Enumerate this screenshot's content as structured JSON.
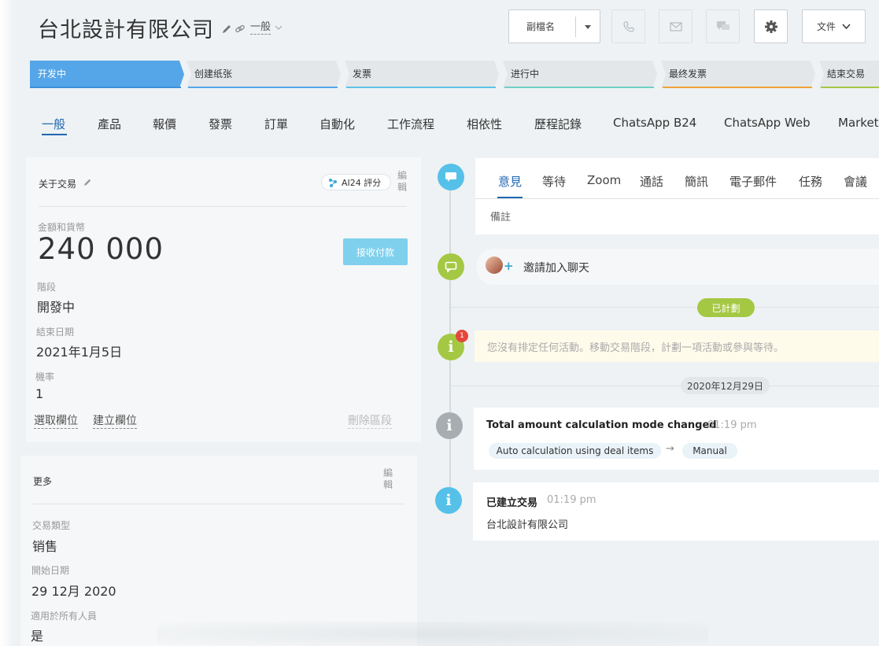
{
  "header": {
    "company_title": "台北設計有限公司",
    "category": "一般",
    "alias_label": "副檔名",
    "document_label": "文件"
  },
  "stages": [
    {
      "label": "开发中",
      "color": "#55a6e8",
      "accent": "#3c8fd8",
      "active": true
    },
    {
      "label": "创建纸张",
      "color": "#e4e7ea",
      "accent": "#55a6e8",
      "active": false
    },
    {
      "label": "发票",
      "color": "#e4e7ea",
      "accent": "#5ec2e8",
      "active": false
    },
    {
      "label": "进行中",
      "color": "#e4e7ea",
      "accent": "#6fcfc6",
      "active": false
    },
    {
      "label": "最终发票",
      "color": "#e4e7ea",
      "accent": "#f0a33b",
      "active": false
    },
    {
      "label": "結束交易",
      "color": "#e4e7ea",
      "accent": "#a5c844",
      "active": false
    }
  ],
  "tabs": [
    {
      "label": "一般",
      "active": true
    },
    {
      "label": "產品"
    },
    {
      "label": "報價"
    },
    {
      "label": "發票"
    },
    {
      "label": "訂單"
    },
    {
      "label": "自動化"
    },
    {
      "label": "工作流程"
    },
    {
      "label": "相依性"
    },
    {
      "label": "歷程記錄"
    },
    {
      "label": "ChatsApp B24"
    },
    {
      "label": "ChatsApp Web"
    },
    {
      "label": "Market"
    }
  ],
  "deal_card": {
    "title": "关于交易",
    "ai_badge": "AI24 評分",
    "edit_label": "編輯",
    "amount_label": "金額和貨幣",
    "amount": "240 000",
    "receive_payment": "接收付款",
    "stage_label": "階段",
    "stage_value": "開發中",
    "close_date_label": "結束日期",
    "close_date_value": "2021年1月5日",
    "probability_label": "機率",
    "probability_value": "1",
    "select_field": "選取欄位",
    "create_field": "建立欄位",
    "delete_section": "刪除區段"
  },
  "more_card": {
    "title": "更多",
    "edit_label": "編輯",
    "deal_type_label": "交易類型",
    "deal_type_value": "销售",
    "start_date_label": "開始日期",
    "start_date_value": "29 12月 2020",
    "available_label": "適用於所有人員",
    "available_value": "是"
  },
  "activity_tabs": [
    "意見",
    "等待",
    "Zoom",
    "通話",
    "簡訊",
    "電子郵件",
    "任務",
    "會議"
  ],
  "note_placeholder": "備註",
  "chat_invite": "邀請加入聊天",
  "planned_label": "已計劃",
  "notice_count": "1",
  "notice_text": "您沒有排定任何活動。移動交易階段，計劃一項活動或參與等待。",
  "date_label": "2020年12月29日",
  "event1": {
    "title": "Total amount calculation mode changed",
    "time": "01:19 pm",
    "from_mode": "Auto calculation using deal items",
    "to_mode": "Manual"
  },
  "event2": {
    "title": "已建立交易",
    "time": "01:19 pm",
    "company": "台北設計有限公司"
  }
}
